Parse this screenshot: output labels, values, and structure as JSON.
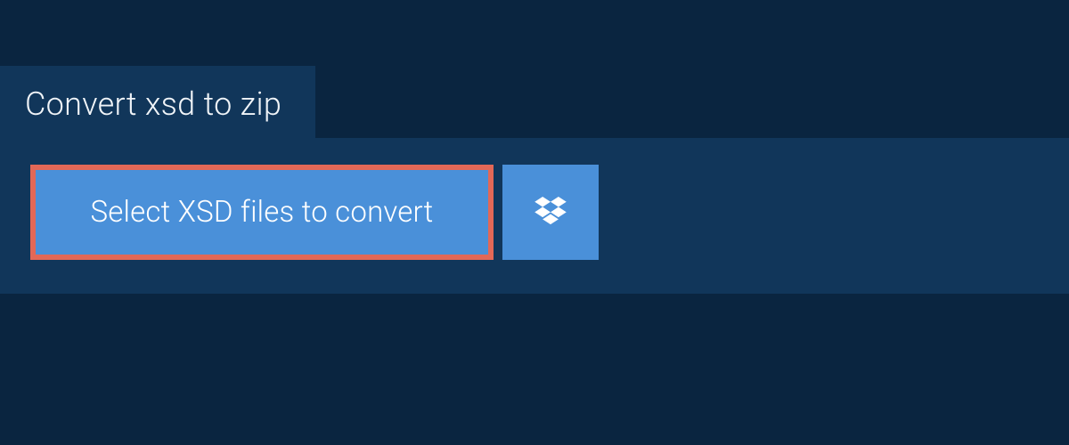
{
  "tab": {
    "label": "Convert xsd to zip"
  },
  "actions": {
    "select_label": "Select XSD files to convert"
  }
}
